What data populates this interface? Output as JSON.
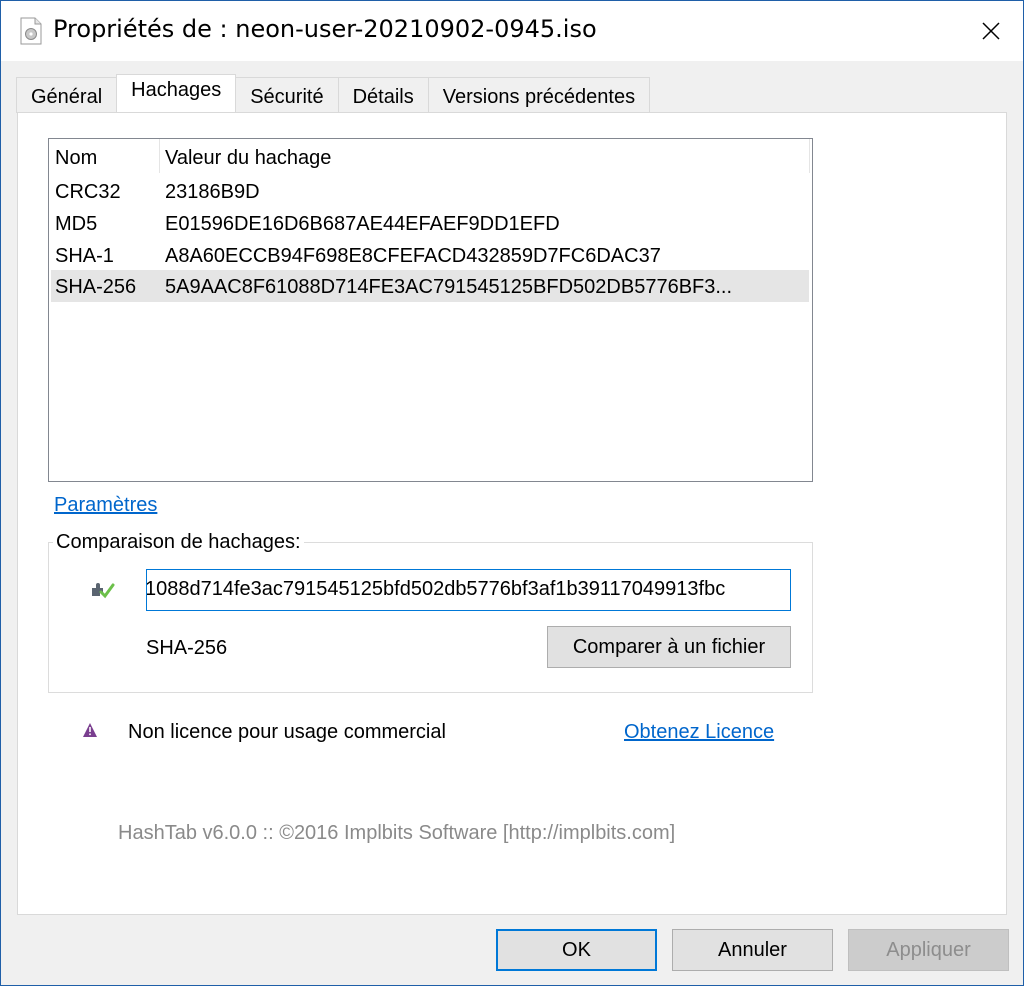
{
  "window": {
    "title": "Propriétés de : neon-user-20210902-0945.iso",
    "close_glyph": "✕"
  },
  "tabs": [
    {
      "label": "Général"
    },
    {
      "label": "Hachages"
    },
    {
      "label": "Sécurité"
    },
    {
      "label": "Détails"
    },
    {
      "label": "Versions précédentes"
    }
  ],
  "hash_list": {
    "columns": [
      "Nom",
      "Valeur du hachage"
    ],
    "rows": [
      {
        "name": "CRC32",
        "value": "23186B9D"
      },
      {
        "name": "MD5",
        "value": "E01596DE16D6B687AE44EFAEF9DD1EFD"
      },
      {
        "name": "SHA-1",
        "value": "A8A60ECCB94F698E8CFEFACD432859D7FC6DAC37"
      },
      {
        "name": "SHA-256",
        "value": "5A9AAC8F61088D714FE3AC791545125BFD502DB5776BF3..."
      }
    ]
  },
  "settings_link": "Paramètres",
  "comparison": {
    "label": "Comparaison de hachages:",
    "input_value": "1088d714fe3ac791545125bfd502db5776bf3af1b39117049913fbc",
    "algorithm": "SHA-256",
    "compare_button": "Comparer à un fichier"
  },
  "license": {
    "text": "Non licence pour usage commercial",
    "link": "Obtenez Licence"
  },
  "footer": "HashTab v6.0.0 :: ©2016 Implbits Software [http://implbits.com]",
  "buttons": {
    "ok": "OK",
    "cancel": "Annuler",
    "apply": "Appliquer"
  },
  "colors": {
    "accent": "#0078d7",
    "link": "#0066cc",
    "warning_icon": "#7a3e8f"
  }
}
